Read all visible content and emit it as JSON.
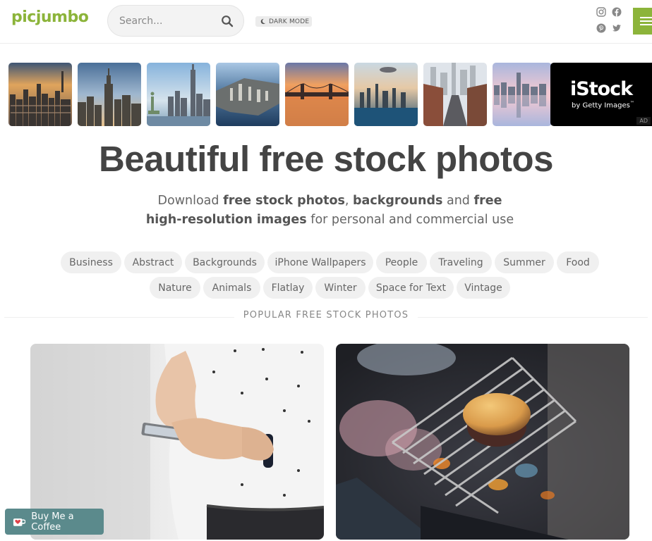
{
  "header": {
    "logo": "picjumbo",
    "search_placeholder": "Search...",
    "dark_mode_label": "DARK MODE",
    "social_icons": [
      "instagram-icon",
      "facebook-icon",
      "pinterest-icon",
      "twitter-icon"
    ],
    "accent_color": "#8cb43a"
  },
  "thumbnails": [
    {
      "name": "new-york-sunset-aerial"
    },
    {
      "name": "empire-state-skyline"
    },
    {
      "name": "statue-of-liberty-skyline"
    },
    {
      "name": "manhattan-aerial-bay"
    },
    {
      "name": "brooklyn-bridge-sunset"
    },
    {
      "name": "manhattan-clouds-aerial"
    },
    {
      "name": "city-street-buildings"
    },
    {
      "name": "skyline-reflection-pink"
    }
  ],
  "ad": {
    "brand": "iStock",
    "tagline": "by Getty Images",
    "tm": "™",
    "badge": "AD"
  },
  "hero": {
    "title": "Beautiful free stock photos",
    "subtitle_parts": [
      "Download ",
      "free stock photos",
      ", ",
      "backgrounds",
      " and ",
      "free high-resolution images",
      " for personal and commercial use"
    ]
  },
  "tags": [
    "Business",
    "Abstract",
    "Backgrounds",
    "iPhone Wallpapers",
    "People",
    "Traveling",
    "Summer",
    "Food",
    "Nature",
    "Animals",
    "Flatlay",
    "Winter",
    "Space for Text",
    "Vintage"
  ],
  "section": {
    "title": "POPULAR FREE STOCK PHOTOS"
  },
  "photos": [
    {
      "name": "man-using-smartphone"
    },
    {
      "name": "burger-on-grill"
    }
  ],
  "coffee": {
    "label": "Buy Me a Coffee",
    "color": "#5b8a8c"
  }
}
